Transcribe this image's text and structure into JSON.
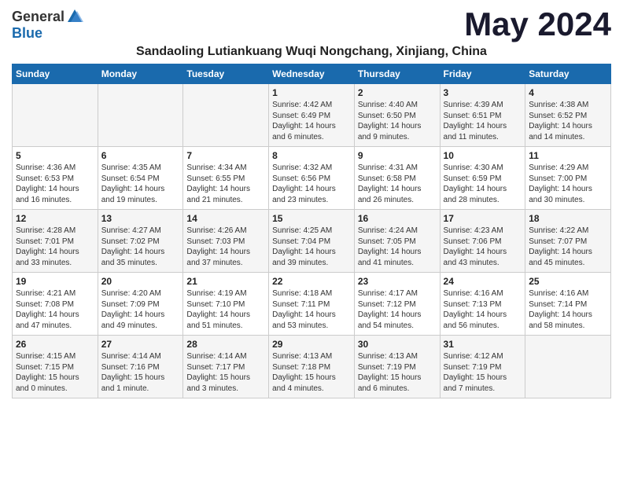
{
  "logo": {
    "general": "General",
    "blue": "Blue"
  },
  "month": "May 2024",
  "location": "Sandaoling Lutiankuang Wuqi Nongchang, Xinjiang, China",
  "headers": [
    "Sunday",
    "Monday",
    "Tuesday",
    "Wednesday",
    "Thursday",
    "Friday",
    "Saturday"
  ],
  "weeks": [
    [
      {
        "day": "",
        "info": ""
      },
      {
        "day": "",
        "info": ""
      },
      {
        "day": "",
        "info": ""
      },
      {
        "day": "1",
        "info": "Sunrise: 4:42 AM\nSunset: 6:49 PM\nDaylight: 14 hours\nand 6 minutes."
      },
      {
        "day": "2",
        "info": "Sunrise: 4:40 AM\nSunset: 6:50 PM\nDaylight: 14 hours\nand 9 minutes."
      },
      {
        "day": "3",
        "info": "Sunrise: 4:39 AM\nSunset: 6:51 PM\nDaylight: 14 hours\nand 11 minutes."
      },
      {
        "day": "4",
        "info": "Sunrise: 4:38 AM\nSunset: 6:52 PM\nDaylight: 14 hours\nand 14 minutes."
      }
    ],
    [
      {
        "day": "5",
        "info": "Sunrise: 4:36 AM\nSunset: 6:53 PM\nDaylight: 14 hours\nand 16 minutes."
      },
      {
        "day": "6",
        "info": "Sunrise: 4:35 AM\nSunset: 6:54 PM\nDaylight: 14 hours\nand 19 minutes."
      },
      {
        "day": "7",
        "info": "Sunrise: 4:34 AM\nSunset: 6:55 PM\nDaylight: 14 hours\nand 21 minutes."
      },
      {
        "day": "8",
        "info": "Sunrise: 4:32 AM\nSunset: 6:56 PM\nDaylight: 14 hours\nand 23 minutes."
      },
      {
        "day": "9",
        "info": "Sunrise: 4:31 AM\nSunset: 6:58 PM\nDaylight: 14 hours\nand 26 minutes."
      },
      {
        "day": "10",
        "info": "Sunrise: 4:30 AM\nSunset: 6:59 PM\nDaylight: 14 hours\nand 28 minutes."
      },
      {
        "day": "11",
        "info": "Sunrise: 4:29 AM\nSunset: 7:00 PM\nDaylight: 14 hours\nand 30 minutes."
      }
    ],
    [
      {
        "day": "12",
        "info": "Sunrise: 4:28 AM\nSunset: 7:01 PM\nDaylight: 14 hours\nand 33 minutes."
      },
      {
        "day": "13",
        "info": "Sunrise: 4:27 AM\nSunset: 7:02 PM\nDaylight: 14 hours\nand 35 minutes."
      },
      {
        "day": "14",
        "info": "Sunrise: 4:26 AM\nSunset: 7:03 PM\nDaylight: 14 hours\nand 37 minutes."
      },
      {
        "day": "15",
        "info": "Sunrise: 4:25 AM\nSunset: 7:04 PM\nDaylight: 14 hours\nand 39 minutes."
      },
      {
        "day": "16",
        "info": "Sunrise: 4:24 AM\nSunset: 7:05 PM\nDaylight: 14 hours\nand 41 minutes."
      },
      {
        "day": "17",
        "info": "Sunrise: 4:23 AM\nSunset: 7:06 PM\nDaylight: 14 hours\nand 43 minutes."
      },
      {
        "day": "18",
        "info": "Sunrise: 4:22 AM\nSunset: 7:07 PM\nDaylight: 14 hours\nand 45 minutes."
      }
    ],
    [
      {
        "day": "19",
        "info": "Sunrise: 4:21 AM\nSunset: 7:08 PM\nDaylight: 14 hours\nand 47 minutes."
      },
      {
        "day": "20",
        "info": "Sunrise: 4:20 AM\nSunset: 7:09 PM\nDaylight: 14 hours\nand 49 minutes."
      },
      {
        "day": "21",
        "info": "Sunrise: 4:19 AM\nSunset: 7:10 PM\nDaylight: 14 hours\nand 51 minutes."
      },
      {
        "day": "22",
        "info": "Sunrise: 4:18 AM\nSunset: 7:11 PM\nDaylight: 14 hours\nand 53 minutes."
      },
      {
        "day": "23",
        "info": "Sunrise: 4:17 AM\nSunset: 7:12 PM\nDaylight: 14 hours\nand 54 minutes."
      },
      {
        "day": "24",
        "info": "Sunrise: 4:16 AM\nSunset: 7:13 PM\nDaylight: 14 hours\nand 56 minutes."
      },
      {
        "day": "25",
        "info": "Sunrise: 4:16 AM\nSunset: 7:14 PM\nDaylight: 14 hours\nand 58 minutes."
      }
    ],
    [
      {
        "day": "26",
        "info": "Sunrise: 4:15 AM\nSunset: 7:15 PM\nDaylight: 15 hours\nand 0 minutes."
      },
      {
        "day": "27",
        "info": "Sunrise: 4:14 AM\nSunset: 7:16 PM\nDaylight: 15 hours\nand 1 minute."
      },
      {
        "day": "28",
        "info": "Sunrise: 4:14 AM\nSunset: 7:17 PM\nDaylight: 15 hours\nand 3 minutes."
      },
      {
        "day": "29",
        "info": "Sunrise: 4:13 AM\nSunset: 7:18 PM\nDaylight: 15 hours\nand 4 minutes."
      },
      {
        "day": "30",
        "info": "Sunrise: 4:13 AM\nSunset: 7:19 PM\nDaylight: 15 hours\nand 6 minutes."
      },
      {
        "day": "31",
        "info": "Sunrise: 4:12 AM\nSunset: 7:19 PM\nDaylight: 15 hours\nand 7 minutes."
      },
      {
        "day": "",
        "info": ""
      }
    ]
  ]
}
